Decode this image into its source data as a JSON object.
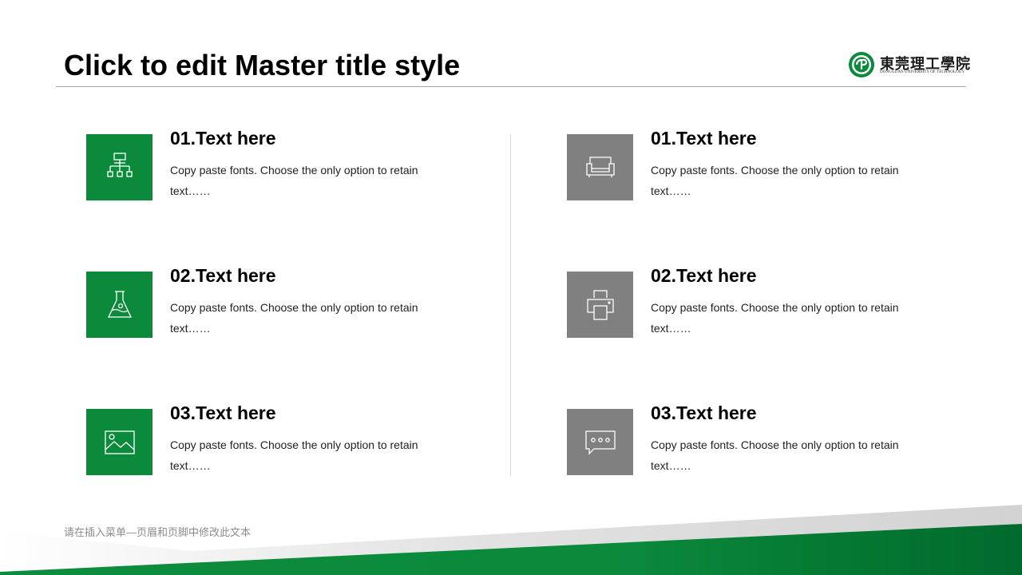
{
  "slide": {
    "title": "Click to edit Master title style",
    "footer": "请在插入菜单—页眉和页脚中修改此文本"
  },
  "logo": {
    "name_cn": "東莞理工學院",
    "name_en": "DONGGUAN UNIVERSITY OF TECHNOLOGY"
  },
  "colors": {
    "green": "#0b8a3c",
    "gray": "#808080"
  },
  "left_items": [
    {
      "title": "01.Text here",
      "desc": "Copy paste fonts. Choose the only option to retain text……",
      "icon": "hierarchy-icon"
    },
    {
      "title": "02.Text here",
      "desc": "Copy paste fonts. Choose the only option to retain text……",
      "icon": "flask-icon"
    },
    {
      "title": "03.Text here",
      "desc": "Copy paste fonts. Choose the only option to retain text……",
      "icon": "image-icon"
    }
  ],
  "right_items": [
    {
      "title": "01.Text here",
      "desc": "Copy paste fonts. Choose the only option to retain text……",
      "icon": "sofa-icon"
    },
    {
      "title": "02.Text here",
      "desc": "Copy paste fonts. Choose the only option to retain text……",
      "icon": "printer-icon"
    },
    {
      "title": "03.Text here",
      "desc": "Copy paste fonts. Choose the only option to retain text……",
      "icon": "chat-bubble-icon"
    }
  ]
}
